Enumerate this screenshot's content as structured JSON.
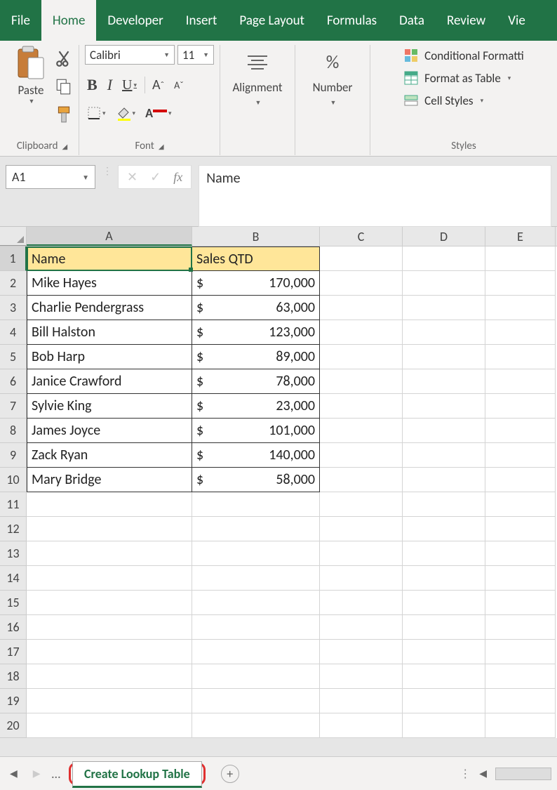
{
  "tabs": {
    "file": "File",
    "home": "Home",
    "developer": "Developer",
    "insert": "Insert",
    "page_layout": "Page Layout",
    "formulas": "Formulas",
    "data": "Data",
    "review": "Review",
    "view": "Vie"
  },
  "ribbon": {
    "clipboard": {
      "paste": "Paste",
      "label": "Clipboard"
    },
    "font": {
      "name": "Calibri",
      "size": "11",
      "label": "Font"
    },
    "alignment": {
      "label": "Alignment"
    },
    "number": {
      "label": "Number",
      "icon": "%"
    },
    "styles": {
      "conditional": "Conditional Formatti",
      "format_table": "Format as Table",
      "cell_styles": "Cell Styles",
      "label": "Styles"
    }
  },
  "namebox": "A1",
  "formula_value": "Name",
  "columns": [
    "A",
    "B",
    "C",
    "D",
    "E"
  ],
  "rows": [
    "1",
    "2",
    "3",
    "4",
    "5",
    "6",
    "7",
    "8",
    "9",
    "10",
    "11",
    "12",
    "13",
    "14",
    "15",
    "16",
    "17",
    "18",
    "19",
    "20"
  ],
  "table": {
    "header": {
      "a": "Name",
      "b": "Sales QTD"
    },
    "data": [
      {
        "a": "Mike Hayes",
        "cur": "$",
        "b": "170,000"
      },
      {
        "a": "Charlie Pendergrass",
        "cur": "$",
        "b": "63,000"
      },
      {
        "a": "Bill Halston",
        "cur": "$",
        "b": "123,000"
      },
      {
        "a": "Bob Harp",
        "cur": "$",
        "b": "89,000"
      },
      {
        "a": "Janice Crawford",
        "cur": "$",
        "b": "78,000"
      },
      {
        "a": "Sylvie King",
        "cur": "$",
        "b": "23,000"
      },
      {
        "a": "James Joyce",
        "cur": "$",
        "b": "101,000"
      },
      {
        "a": "Zack Ryan",
        "cur": "$",
        "b": "140,000"
      },
      {
        "a": "Mary Bridge",
        "cur": "$",
        "b": "58,000"
      }
    ]
  },
  "sheet_tab": "Create Lookup Table"
}
